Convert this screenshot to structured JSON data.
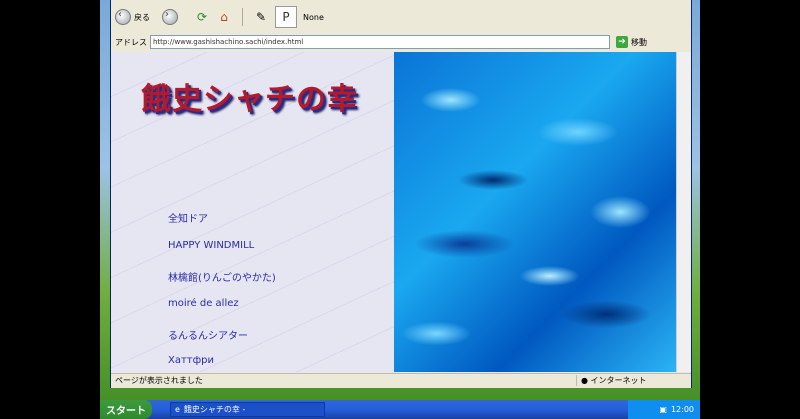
{
  "toolbar": {
    "back_label": "戻る",
    "none_label": "None"
  },
  "address": {
    "label": "アドレス",
    "url": "http://www.gashishachino.sachi/index.html",
    "go_label": "移動"
  },
  "page": {
    "title": "餓史シャチの幸",
    "links": [
      "全知ドア",
      "HAPPY WINDMILL",
      "林檎館(りんごのやかた)",
      "moiré de allez",
      "るんるんシアター",
      "Хаттфри"
    ]
  },
  "status": {
    "text": "ページが表示されました",
    "zone": "インターネット"
  },
  "taskbar": {
    "start_label": "スタート",
    "task_label": "餓史シャチの幸 -",
    "clock": "12:00"
  }
}
